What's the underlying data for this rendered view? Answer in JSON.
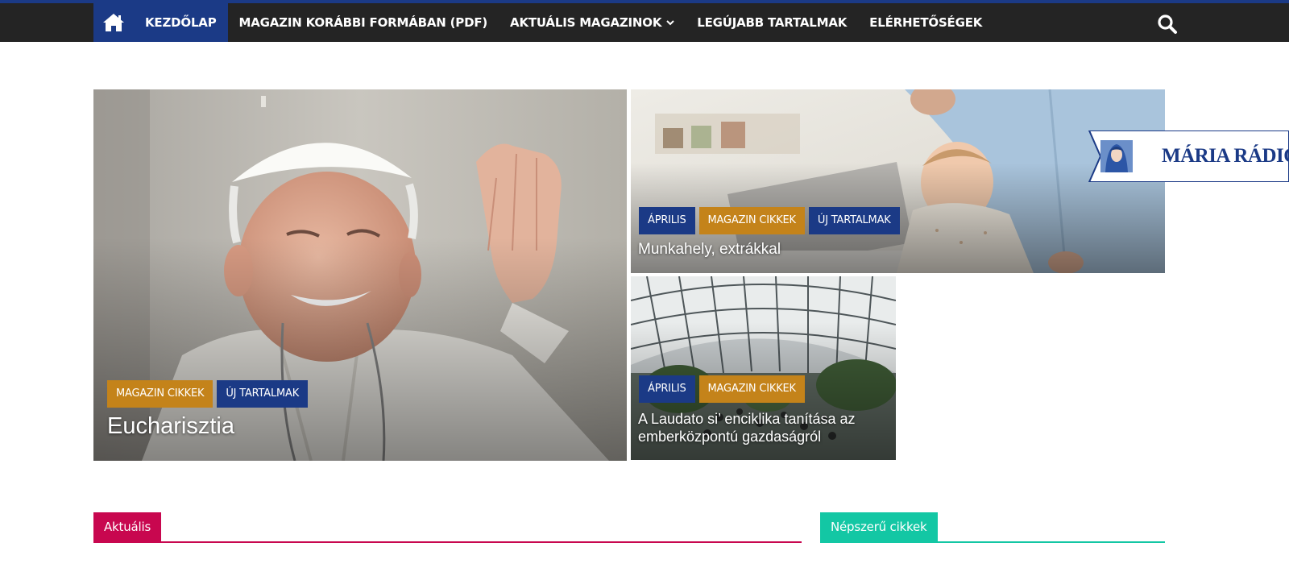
{
  "colors": {
    "nav_background": "#242424",
    "accent_navy": "#1b3a86",
    "accent_gold": "#c4831a",
    "section_aktualis": "#c8074f",
    "section_nepszeru": "#13c7a4"
  },
  "nav": {
    "home_icon": "home-icon",
    "items": [
      {
        "label": "KEZDŐLAP",
        "active": true
      },
      {
        "label": "MAGAZIN KORÁBBI FORMÁBAN (PDF)"
      },
      {
        "label": "AKTUÁLIS MAGAZINOK",
        "has_dropdown": true
      },
      {
        "label": "LEGÚJABB TARTALMAK"
      },
      {
        "label": "ELÉRHETŐSÉGEK"
      }
    ],
    "search_icon": "search-icon"
  },
  "hero": {
    "main": {
      "badges": [
        "MAGAZIN CIKKEK",
        "ÚJ TARTALMAK"
      ],
      "title": "Eucharisztia",
      "image": "pope-waving-photo"
    },
    "top_right": {
      "badges": [
        "ÁPRILIS",
        "MAGAZIN CIKKEK",
        "ÚJ TARTALMAK"
      ],
      "title": "Munkahely, extrákkal",
      "image": "father-with-baby-at-laptop-photo"
    },
    "bottom_right": {
      "badges": [
        "ÁPRILIS",
        "MAGAZIN CIKKEK"
      ],
      "title_line1": "A Laudato si’ enciklika tanítása az",
      "title_line2": "emberközpontú gazdaságról",
      "image": "glass-atrium-crowd-photo"
    }
  },
  "radio_badge": {
    "text": "MÁRIA RÁDIÓ",
    "icon": "virgin-mary-icon"
  },
  "sections": {
    "aktualis": "Aktuális",
    "nepszeru": "Népszerű cikkek"
  }
}
